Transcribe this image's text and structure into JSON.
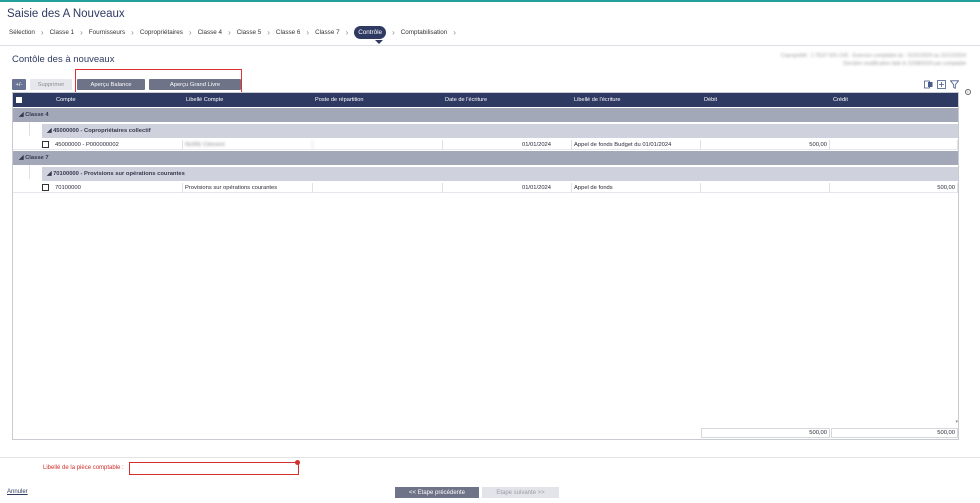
{
  "app": {
    "title": "Saisie des A Nouveaux"
  },
  "wizard": {
    "steps": [
      "Sélection",
      "Classe 1",
      "Fournisseurs",
      "Copropriétaires",
      "Classe 4",
      "Classe 5",
      "Classe 6",
      "Classe 7",
      "Contrôle",
      "Comptabilisation"
    ],
    "active_index": 8
  },
  "page": {
    "title": "Contôle des à nouveaux",
    "info_line1": "Copropriété : 1 TEST EN LIVE - Exercice comptable du : 01/01/2024 au 31/12/2024",
    "info_line2": "Dernière modification faite le 22/08/2024 par comptable"
  },
  "toolbar": {
    "toggle_label": "+/-",
    "delete_label": "Supprimer",
    "balance_label": "Aperçu Balance",
    "grand_livre_label": "Aperçu Grand Livre"
  },
  "grid": {
    "columns": [
      "Compte",
      "Libellé Compte",
      "Poste de répartition",
      "Date de l'écriture",
      "Libellé de l'écriture",
      "Débit",
      "Crédit"
    ],
    "groups": [
      {
        "label": "Classe 4",
        "subgroups": [
          {
            "label": "45000000 - Copropriétaires collectif",
            "rows": [
              {
                "compte": "45000000 - P000000002",
                "libelle_compte": "NURE Clément",
                "poste": "",
                "date": "01/01/2024",
                "libelle_ecriture": "Appel de fonds Budget du 01/01/2024",
                "debit": "500,00",
                "credit": ""
              }
            ]
          }
        ]
      },
      {
        "label": "Classe 7",
        "subgroups": [
          {
            "label": "70100000 - Provisions sur opérations courantes",
            "rows": [
              {
                "compte": "70100000",
                "libelle_compte": "Provisions sur opérations courantes",
                "poste": "",
                "date": "01/01/2024",
                "libelle_ecriture": "Appel de fonds",
                "debit": "",
                "credit": "500,00"
              }
            ]
          }
        ]
      }
    ],
    "totals": {
      "debit": "500,00",
      "credit": "500,00"
    }
  },
  "form": {
    "piece_label": "Libellé de la pièce comptable :",
    "piece_value": ""
  },
  "footer": {
    "cancel_label": "Annuler",
    "prev_label": "<< Etape précédente",
    "next_label": "Etape suivante >>"
  },
  "colors": {
    "primary": "#2f3a62",
    "accent": "#21a19b",
    "error": "#d32f2f",
    "group_bar": "#a3a8b9",
    "subgroup_bar": "#cfd2dd"
  }
}
